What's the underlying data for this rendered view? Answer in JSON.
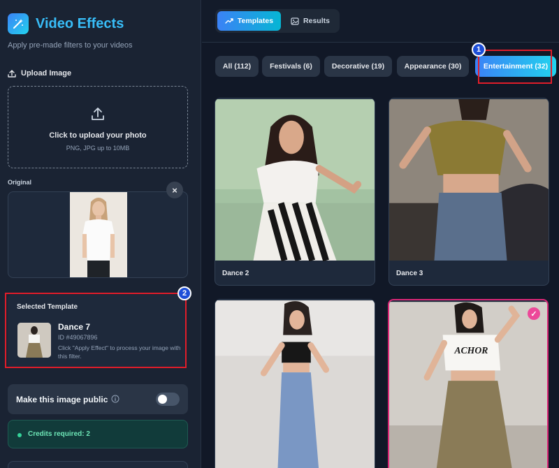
{
  "sidebar": {
    "title": "Video Effects",
    "subtitle": "Apply pre-made filters to your videos",
    "upload_label": "Upload Image",
    "dropzone_title": "Click to upload your photo",
    "dropzone_sub": "PNG, JPG up to 10MB",
    "original_label": "Original",
    "close_symbol": "×",
    "selected_heading": "Selected Template",
    "selected_name": "Dance 7",
    "selected_id": "ID #49067896",
    "selected_desc": "Click \"Apply Effect\" to process your image with this filter.",
    "public_label": "Make this image public",
    "public_toggle_on": false,
    "credits": "Credits required: 2"
  },
  "tabs": [
    {
      "label": "Templates",
      "icon": "trend-icon",
      "active": true
    },
    {
      "label": "Results",
      "icon": "image-icon",
      "active": false
    }
  ],
  "filters": [
    {
      "label": "All (112)",
      "active": false
    },
    {
      "label": "Festivals (6)",
      "active": false
    },
    {
      "label": "Decorative (19)",
      "active": false
    },
    {
      "label": "Appearance (30)",
      "active": false
    },
    {
      "label": "Entertainment (32)",
      "active": true
    }
  ],
  "annotations": [
    "1",
    "2"
  ],
  "cards": [
    {
      "name": "Dance 2",
      "selected": false
    },
    {
      "name": "Dance 3",
      "selected": false
    },
    {
      "name": "",
      "selected": false
    },
    {
      "name": "",
      "selected": true
    }
  ],
  "check_symbol": "✓",
  "colors": {
    "accent_blue": "#3b82f6",
    "accent_cyan": "#22d3ee",
    "highlight_red": "#e11d2a",
    "selection_pink": "#ec4899",
    "credits_green": "#6ee7b7"
  }
}
